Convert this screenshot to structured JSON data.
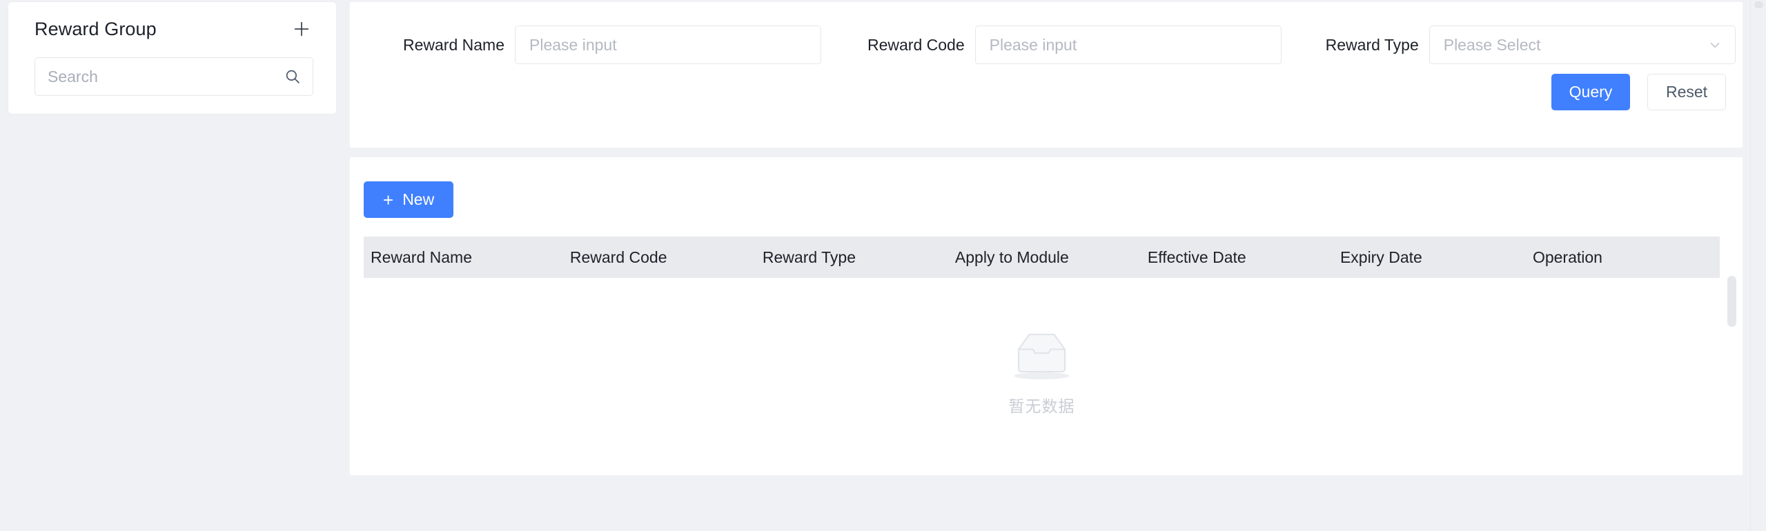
{
  "sidebar": {
    "title": "Reward Group",
    "add_icon": "plus-icon",
    "search": {
      "placeholder": "Search",
      "value": "",
      "icon": "search-icon"
    }
  },
  "filter": {
    "fields": [
      {
        "label": "Reward Name",
        "type": "input",
        "placeholder": "Please input",
        "value": ""
      },
      {
        "label": "Reward Code",
        "type": "input",
        "placeholder": "Please input",
        "value": ""
      },
      {
        "label": "Reward Type",
        "type": "select",
        "placeholder": "Please Select",
        "value": "",
        "icon": "chevron-down-icon"
      }
    ],
    "query_label": "Query",
    "reset_label": "Reset"
  },
  "toolbar": {
    "new_label": "New",
    "new_icon": "plus-icon"
  },
  "table": {
    "columns": [
      "Reward Name",
      "Reward Code",
      "Reward Type",
      "Apply to Module",
      "Effective Date",
      "Expiry Date",
      "Operation"
    ],
    "rows": [],
    "empty": {
      "icon": "empty-inbox-icon",
      "text": "暂无数据"
    }
  },
  "colors": {
    "primary": "#4080ff",
    "page_background": "#f0f1f5",
    "card_background": "#ffffff",
    "table_header_background": "#e9eaee",
    "border": "#e5e6eb",
    "placeholder_text": "#b4b9c2",
    "empty_text": "#c9cdd4",
    "text": "#1d2129"
  }
}
